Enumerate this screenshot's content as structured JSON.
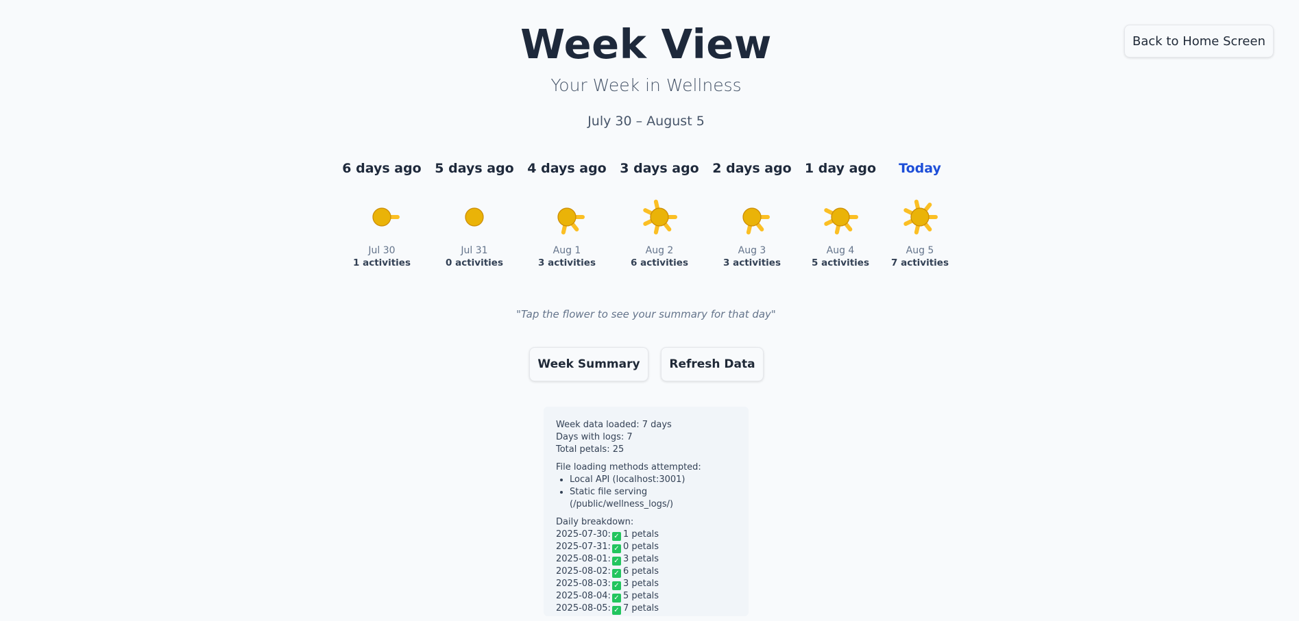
{
  "header": {
    "title": "Week View",
    "subtitle": "Your Week in Wellness",
    "date_range": "July 30 – August 5",
    "back_button_label": "Back to Home Screen"
  },
  "days": [
    {
      "label": "6 days ago",
      "date": "Jul 30",
      "count_text": "1 activities",
      "petals": 1,
      "today": false
    },
    {
      "label": "5 days ago",
      "date": "Jul 31",
      "count_text": "0 activities",
      "petals": 0,
      "today": false
    },
    {
      "label": "4 days ago",
      "date": "Aug 1",
      "count_text": "3 activities",
      "petals": 3,
      "today": false
    },
    {
      "label": "3 days ago",
      "date": "Aug 2",
      "count_text": "6 activities",
      "petals": 6,
      "today": false
    },
    {
      "label": "2 days ago",
      "date": "Aug 3",
      "count_text": "3 activities",
      "petals": 3,
      "today": false
    },
    {
      "label": "1 day ago",
      "date": "Aug 4",
      "count_text": "5 activities",
      "petals": 5,
      "today": false
    },
    {
      "label": "Today",
      "date": "Aug 5",
      "count_text": "7 activities",
      "petals": 7,
      "today": true
    }
  ],
  "hint": "\"Tap the flower to see your summary for that day\"",
  "actions": {
    "week_summary_label": "Week Summary",
    "refresh_label": "Refresh Data"
  },
  "debug": {
    "stats": [
      "Week data loaded: 7 days",
      "Days with logs: 7",
      "Total petals: 25"
    ],
    "methods_title": "File loading methods attempted:",
    "methods": [
      "Local API (localhost:3001)",
      "Static file serving (/public/wellness_logs/)"
    ],
    "breakdown_title": "Daily breakdown:",
    "breakdown": [
      {
        "date": "2025-07-30:",
        "status_icon": "check-icon",
        "petals_text": "1 petals"
      },
      {
        "date": "2025-07-31:",
        "status_icon": "check-icon",
        "petals_text": "0 petals"
      },
      {
        "date": "2025-08-01:",
        "status_icon": "check-icon",
        "petals_text": "3 petals"
      },
      {
        "date": "2025-08-02:",
        "status_icon": "check-icon",
        "petals_text": "6 petals"
      },
      {
        "date": "2025-08-03:",
        "status_icon": "check-icon",
        "petals_text": "3 petals"
      },
      {
        "date": "2025-08-04:",
        "status_icon": "check-icon",
        "petals_text": "5 petals"
      },
      {
        "date": "2025-08-05:",
        "status_icon": "check-icon",
        "petals_text": "7 petals"
      }
    ]
  },
  "colors": {
    "flower_center": "#eab308",
    "flower_center_stroke": "#ca8a04",
    "petal": "#fbbf24",
    "today_label": "#1d4ed8",
    "check": "#22c55e"
  }
}
